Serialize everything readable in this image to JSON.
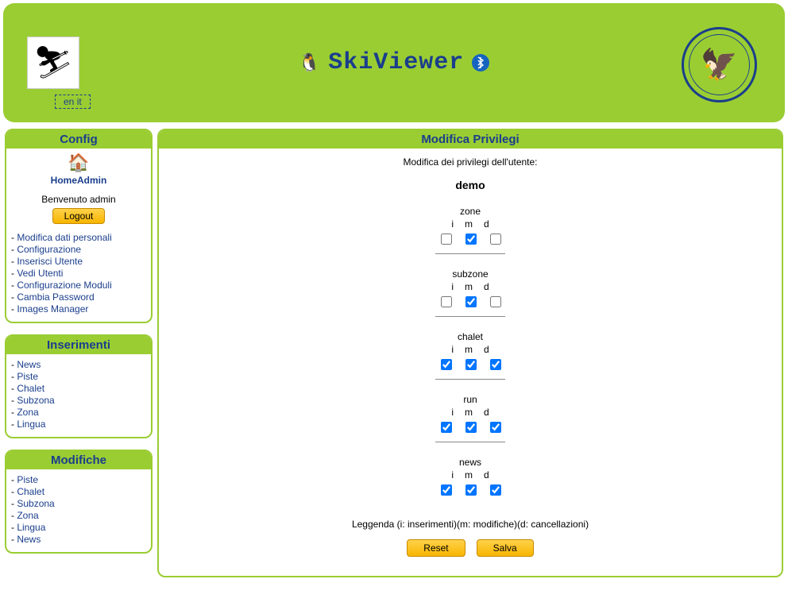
{
  "header": {
    "title": "SkiViewer",
    "lang_en": "en",
    "lang_it": "it"
  },
  "sidebar": {
    "config": {
      "title": "Config",
      "home_label": "HomeAdmin",
      "welcome": "Benvenuto admin",
      "logout": "Logout",
      "items": [
        "Modifica dati personali",
        "Configurazione",
        "Inserisci Utente",
        "Vedi Utenti",
        "Configurazione Moduli",
        "Cambia Password",
        "Images Manager"
      ]
    },
    "inserimenti": {
      "title": "Inserimenti",
      "items": [
        "News",
        "Piste",
        "Chalet",
        "Subzona",
        "Zona",
        "Lingua"
      ]
    },
    "modifiche": {
      "title": "Modifiche",
      "items": [
        "Piste",
        "Chalet",
        "Subzona",
        "Zona",
        "Lingua",
        "News"
      ]
    }
  },
  "main": {
    "title": "Modifica Privilegi",
    "subtitle": "Modifica dei privilegi dell'utente:",
    "username": "demo",
    "col_i": "i",
    "col_m": "m",
    "col_d": "d",
    "legend": "Leggenda (i: inserimenti)(m: modifiche)(d: cancellazioni)",
    "reset": "Reset",
    "save": "Salva",
    "groups": [
      {
        "name": "zone",
        "i": false,
        "m": true,
        "d": false
      },
      {
        "name": "subzone",
        "i": false,
        "m": true,
        "d": false
      },
      {
        "name": "chalet",
        "i": true,
        "m": true,
        "d": true
      },
      {
        "name": "run",
        "i": true,
        "m": true,
        "d": true
      },
      {
        "name": "news",
        "i": true,
        "m": true,
        "d": true
      }
    ]
  }
}
